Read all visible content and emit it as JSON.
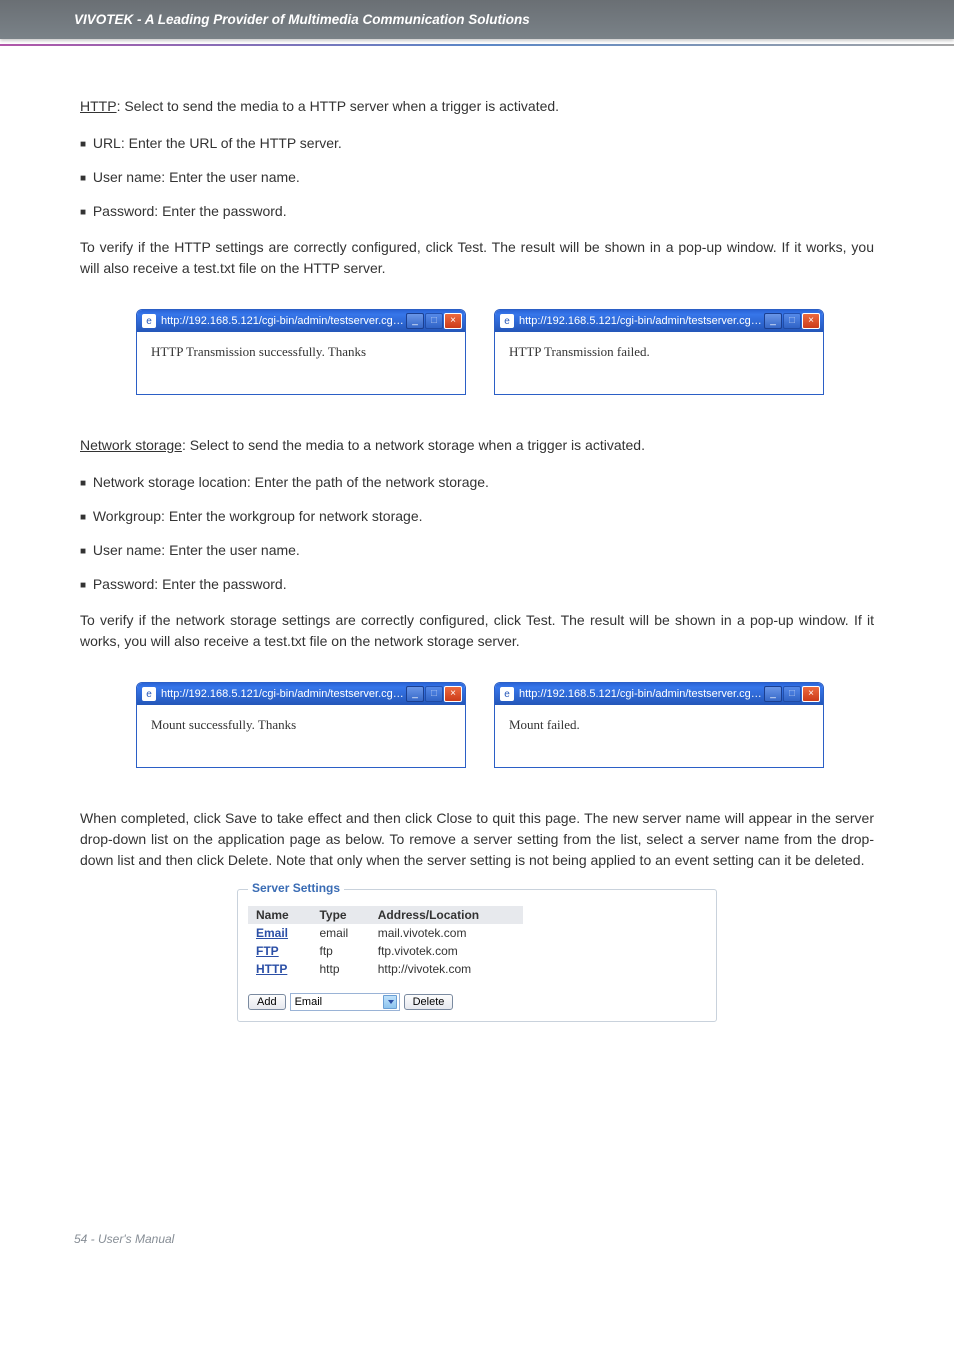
{
  "header": {
    "title": "VIVOTEK - A Leading Provider of Multimedia Communication Solutions"
  },
  "http_section": {
    "heading": "HTTP",
    "heading_tail": ": Select to send the media to a HTTP server when a trigger is activated.",
    "url_item": "URL: Enter the URL of the HTTP server.",
    "user_item": "User name: Enter the user name.",
    "pass_item": "Password: Enter the password.",
    "verify": "To verify if the HTTP settings are correctly configured, click Test. The result will be shown in a pop-up window. If it works, you will also receive a test.txt file on the HTTP server.",
    "popup_url": "http://192.168.5.121/cgi-bin/admin/testserver.cgi - ...",
    "popup_ok": "HTTP Transmission successfully. Thanks",
    "popup_fail": "HTTP Transmission failed."
  },
  "ns_section": {
    "heading": "Network storage",
    "heading_tail": ": Select to send the media to a network storage when a trigger is activated.",
    "loc_item": "Network storage location: Enter the path of the network storage.",
    "wg_item": "Workgroup: Enter the workgroup for network storage.",
    "user_item": "User name: Enter the user name.",
    "pass_item": "Password: Enter the password.",
    "verify": "To verify if the network storage settings are correctly configured, click Test. The result will be shown in a pop-up window. If it works, you will also receive a test.txt file on the network storage server.",
    "popup_url": "http://192.168.5.121/cgi-bin/admin/testserver.cgi - ...",
    "popup_ok": "Mount successfully. Thanks",
    "popup_fail": "Mount failed."
  },
  "save_paragraph": "When completed, click Save to take effect and then click Close to quit this page. The new server name will appear in the server drop-down list on the application page as below. To remove a server setting from the list, select a server name from the drop-down list and then click Delete. Note that only when the server setting is not being applied to an event setting can it be deleted.",
  "server_settings": {
    "legend": "Server Settings",
    "headers": {
      "name": "Name",
      "type": "Type",
      "loc": "Address/Location"
    },
    "rows": [
      {
        "name": "Email",
        "type": "email",
        "loc": "mail.vivotek.com"
      },
      {
        "name": "FTP",
        "type": "ftp",
        "loc": "ftp.vivotek.com"
      },
      {
        "name": "HTTP",
        "type": "http",
        "loc": "http://vivotek.com"
      }
    ],
    "add_label": "Add",
    "delete_label": "Delete",
    "selected": "Email"
  },
  "footer": {
    "text": "54 - User's Manual"
  }
}
